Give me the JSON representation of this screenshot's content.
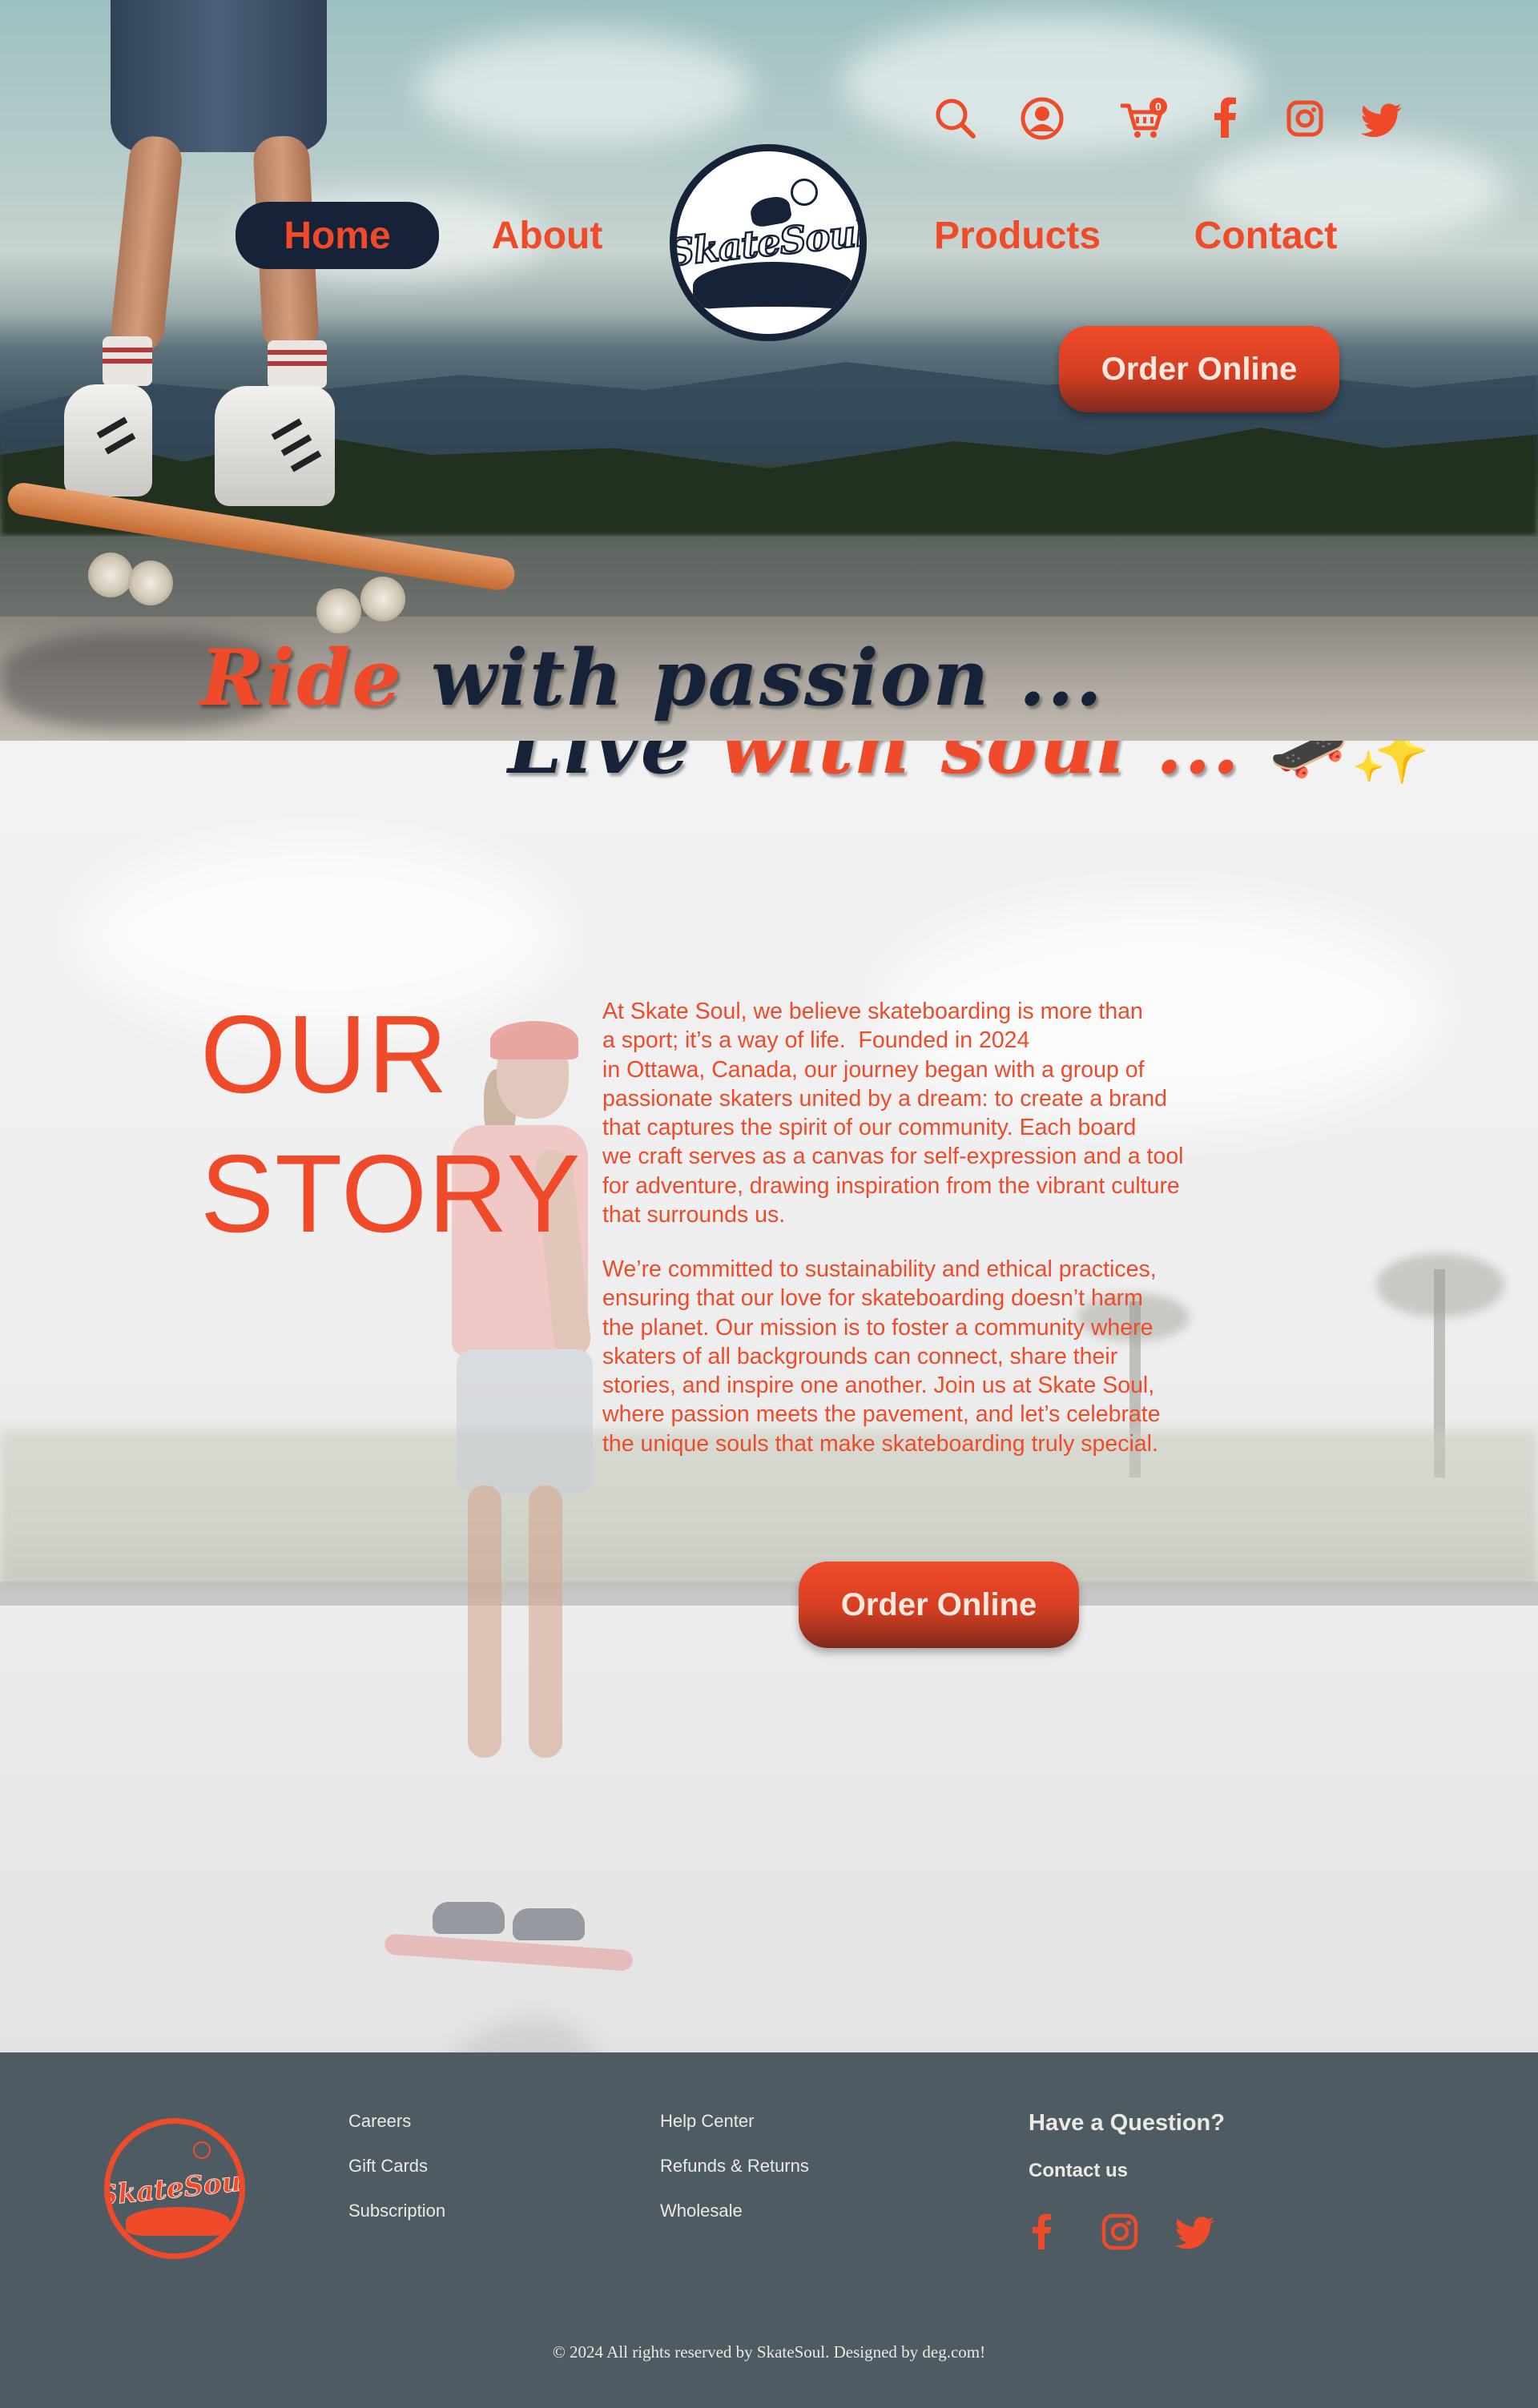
{
  "brand": {
    "name": "SkateSoul"
  },
  "colors": {
    "accent": "#ef4b2a",
    "navy": "#152238",
    "footer_bg": "#4f5b62",
    "footer_text": "#ece8e4"
  },
  "header": {
    "icons": [
      "search-icon",
      "account-icon",
      "cart-icon",
      "facebook-icon",
      "instagram-icon",
      "twitter-icon"
    ],
    "cart_count": "0",
    "nav": [
      {
        "label": "Home",
        "active": true
      },
      {
        "label": "About",
        "active": false
      },
      {
        "label": "Products",
        "active": false
      },
      {
        "label": "Contact",
        "active": false
      }
    ],
    "order_button": "Order Online"
  },
  "hero": {
    "line1_red": "Ride",
    "line1_rest": " with passion ...",
    "line2_navy": "Live",
    "line2_red": " with soul ... ",
    "line2_emoji": "🛹✨"
  },
  "story": {
    "heading_line1": "OUR",
    "heading_line2": "STORY",
    "paragraph1": [
      "At Skate Soul, we believe skateboarding is more than",
      "a sport; it’s a way of life.  Founded in 2024",
      "in Ottawa, Canada, our journey began with a group of",
      "passionate skaters united by a dream: to create a brand",
      "that captures the spirit of our community. Each board",
      "we craft serves as a canvas for self-expression and a tool",
      "for adventure, drawing inspiration from the vibrant culture",
      "that surrounds us."
    ],
    "paragraph2": [
      "We’re committed to sustainability and ethical practices,",
      "ensuring that our love for skateboarding doesn’t harm",
      "the planet. Our mission is to foster a community where",
      "skaters of all backgrounds can connect, share their",
      "stories, and inspire one another. Join us at Skate Soul,",
      "where passion meets the pavement, and let’s celebrate",
      "the unique souls that make skateboarding truly special."
    ],
    "order_button": "Order Online"
  },
  "footer": {
    "col1": [
      "Careers",
      "Gift Cards",
      "Subscription"
    ],
    "col2": [
      "Help Center",
      "Refunds & Returns",
      "Wholesale"
    ],
    "question_heading": "Have a Question?",
    "contact_label": "Contact us",
    "social_icons": [
      "facebook-icon",
      "instagram-icon",
      "twitter-icon"
    ],
    "copyright": "© 2024 All rights reserved by SkateSoul. Designed by deg.com!"
  }
}
